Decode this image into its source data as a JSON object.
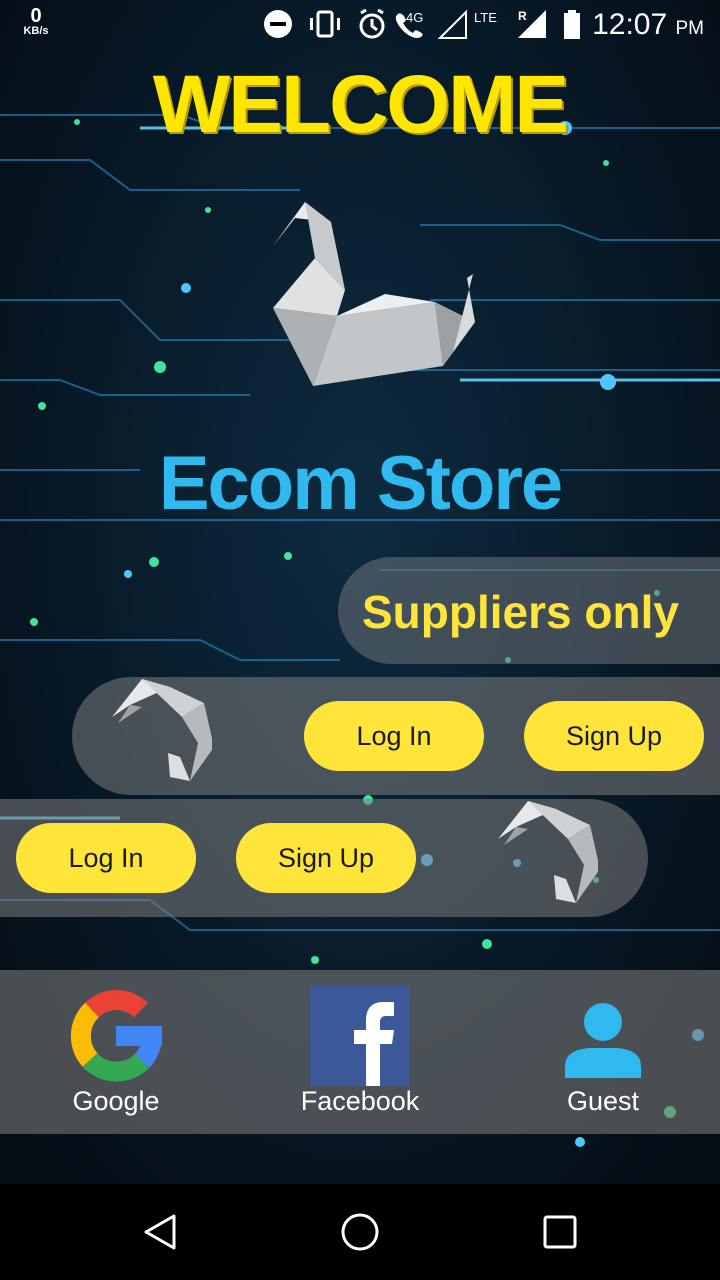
{
  "status_bar": {
    "speed_value": "0",
    "speed_unit": "KB/s",
    "network_label": "4G",
    "lte_label": "LTE",
    "roaming_label": "R",
    "time": "12:07",
    "ampm": "PM"
  },
  "welcome": "WELCOME",
  "store_name": "Ecom Store",
  "suppliers": {
    "label": "Suppliers only",
    "login_label": "Log In",
    "signup_label": "Sign Up"
  },
  "customers": {
    "login_label": "Log In",
    "signup_label": "Sign Up"
  },
  "social": {
    "google_label": "Google",
    "facebook_label": "Facebook",
    "guest_label": "Guest"
  },
  "colors": {
    "accent_yellow": "#ffe43a",
    "brand_blue": "#2fb9ee",
    "background": "#061420"
  }
}
